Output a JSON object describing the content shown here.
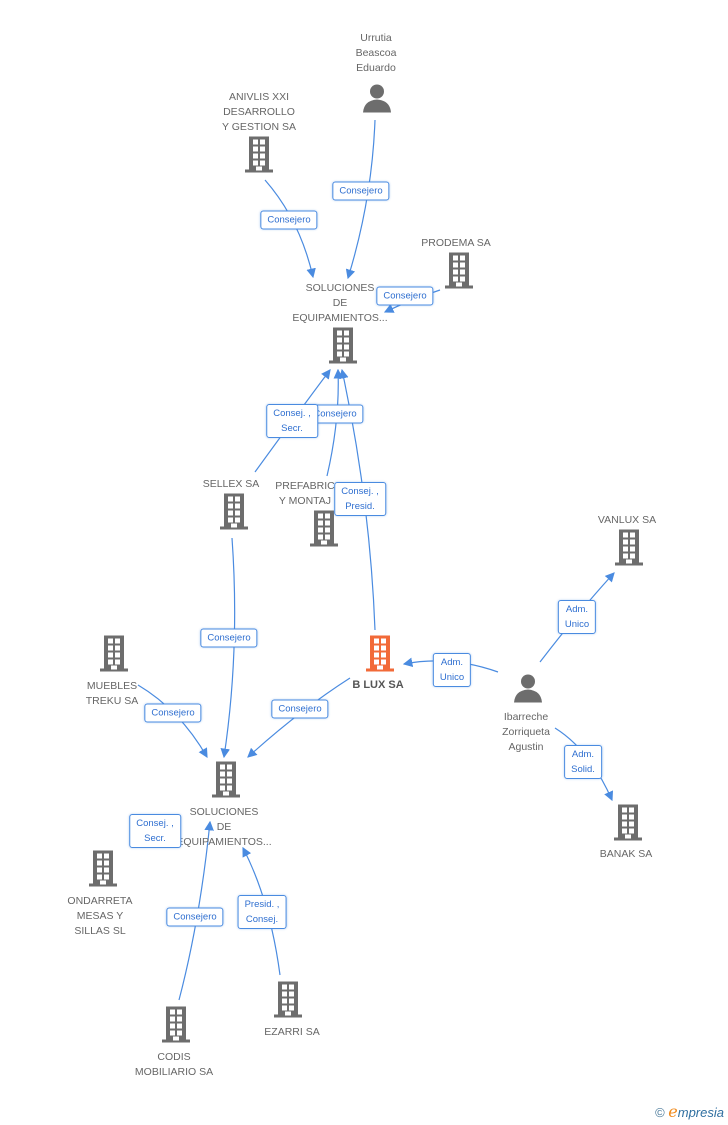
{
  "colors": {
    "company": "#6d6d6d",
    "focus": "#f26a38",
    "edge": "#4a8be0"
  },
  "nodes": [
    {
      "id": "urrutia",
      "type": "person",
      "lines": [
        "Urrutia",
        "Beascoa",
        "Eduardo"
      ]
    },
    {
      "id": "anivlis",
      "type": "company",
      "lines": [
        "ANIVLIS XXI",
        "DESARROLLO",
        "Y GESTION SA"
      ]
    },
    {
      "id": "prodema",
      "type": "company",
      "lines": [
        "PRODEMA SA"
      ]
    },
    {
      "id": "soltop",
      "type": "company",
      "lines": [
        "SOLUCIONES",
        "DE",
        "EQUIPAMIENTOS..."
      ]
    },
    {
      "id": "sellex",
      "type": "company",
      "lines": [
        "SELLEX SA"
      ]
    },
    {
      "id": "prefabric",
      "type": "company",
      "lines": [
        "PREFABRIC",
        "Y MONTAJ"
      ]
    },
    {
      "id": "vanlux",
      "type": "company",
      "lines": [
        "VANLUX SA"
      ]
    },
    {
      "id": "blux",
      "type": "focus",
      "lines": [
        "B LUX SA"
      ]
    },
    {
      "id": "muebles",
      "type": "company",
      "lines": [
        "MUEBLES",
        "TREKU SA"
      ]
    },
    {
      "id": "ibarreche",
      "type": "person",
      "lines": [
        "Ibarreche",
        "Zorriqueta",
        "Agustin"
      ]
    },
    {
      "id": "solbot",
      "type": "company",
      "lines": [
        "SOLUCIONES",
        "DE",
        "EQUIPAMIENTOS..."
      ]
    },
    {
      "id": "banak",
      "type": "company",
      "lines": [
        "BANAK SA"
      ]
    },
    {
      "id": "ondarreta",
      "type": "company",
      "lines": [
        "ONDARRETA",
        "MESAS Y",
        "SILLAS SL"
      ]
    },
    {
      "id": "ezarri",
      "type": "company",
      "lines": [
        "EZARRI SA"
      ]
    },
    {
      "id": "codis",
      "type": "company",
      "lines": [
        "CODIS",
        "MOBILIARIO SA"
      ]
    }
  ],
  "edges": [
    {
      "from": "urrutia",
      "to": "soltop",
      "label": [
        "Consejero"
      ]
    },
    {
      "from": "anivlis",
      "to": "soltop",
      "label": [
        "Consejero"
      ]
    },
    {
      "from": "prodema",
      "to": "soltop",
      "label": [
        "Consejero"
      ]
    },
    {
      "from": "prefabric",
      "to": "soltop",
      "label": [
        "Consejero"
      ]
    },
    {
      "from": "sellex",
      "to": "soltop",
      "label": [
        "Consej. ,",
        "Secr."
      ]
    },
    {
      "from": "blux",
      "to": "soltop",
      "label": [
        "Consej. ,",
        "Presid."
      ]
    },
    {
      "from": "sellex",
      "to": "solbot",
      "label": [
        "Consejero"
      ]
    },
    {
      "from": "muebles",
      "to": "solbot",
      "label": [
        "Consejero"
      ]
    },
    {
      "from": "blux",
      "to": "solbot",
      "label": [
        "Consejero"
      ]
    },
    {
      "from": "ibarreche",
      "to": "blux",
      "label": [
        "Adm.",
        "Unico"
      ]
    },
    {
      "from": "ibarreche",
      "to": "vanlux",
      "label": [
        "Adm.",
        "Unico"
      ]
    },
    {
      "from": "ibarreche",
      "to": "banak",
      "label": [
        "Adm.",
        "Solid."
      ]
    },
    {
      "from": "ondarreta",
      "to": "solbot",
      "label": [
        "Consej. ,",
        "Secr."
      ]
    },
    {
      "from": "codis",
      "to": "solbot",
      "label": [
        "Consejero"
      ]
    },
    {
      "from": "ezarri",
      "to": "solbot",
      "label": [
        "Presid. ,",
        "Consej."
      ]
    }
  ],
  "footer": {
    "copyright": "©",
    "brand_first": "e",
    "brand_rest": "mpresia"
  }
}
